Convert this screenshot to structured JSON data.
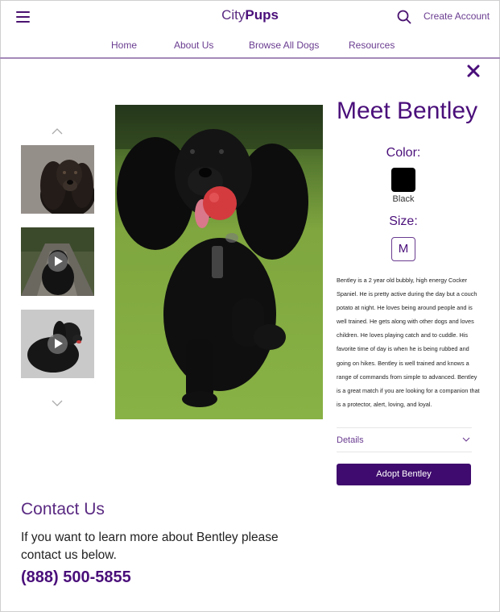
{
  "header": {
    "brand_light": "City",
    "brand_bold": "Pups",
    "create_account": "Create Account",
    "icons": [
      "menu-icon",
      "search-icon"
    ]
  },
  "nav": {
    "items": [
      {
        "label": "Home"
      },
      {
        "label": "About Us"
      },
      {
        "label": "Browse All Dogs"
      },
      {
        "label": "Resources"
      }
    ]
  },
  "modal": {
    "close_icon": "close-icon"
  },
  "gallery": {
    "icons": [
      "chevron-up-icon",
      "chevron-down-icon",
      "play-icon"
    ]
  },
  "dog": {
    "title": "Meet Bentley",
    "color_label": "Color:",
    "color_value": "Black",
    "color_hex": "#000000",
    "size_label": "Size:",
    "size_value": "M",
    "description": "Bentley is a 2 year old bubbly, high energy Cocker Spaniel. He is pretty active during the day but a couch potato at night. He loves being around people and is well trained. He gets along with other dogs and loves children. He loves playing catch and to cuddle. His favorite time of day is when he is being rubbed and going on hikes. Bentley is well trained and knows a range of commands from simple to advanced. Bentley is a great match if you are looking for a companion that is a protector, alert, loving, and loyal.",
    "details_label": "Details",
    "adopt_label": "Adopt Bentley"
  },
  "contact": {
    "title": "Contact Us",
    "text": "If you want to learn more about Bentley please contact us below.",
    "phone": "(888) 500-5855"
  },
  "colors": {
    "brand_purple": "#4a0f7a",
    "button_purple": "#3f0b6e",
    "nav_rule": "#a48ab8"
  }
}
